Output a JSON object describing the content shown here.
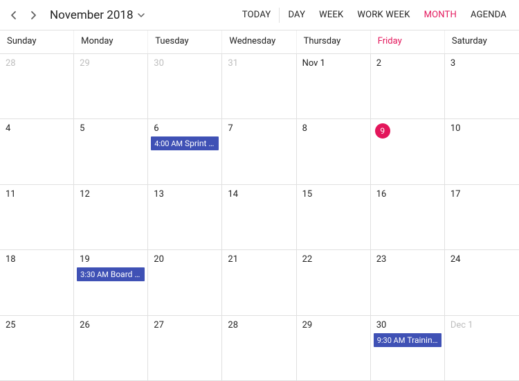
{
  "toolbar": {
    "title": "November 2018",
    "today_label": "TODAY",
    "views": [
      {
        "key": "day",
        "label": "DAY",
        "active": false
      },
      {
        "key": "week",
        "label": "WEEK",
        "active": false
      },
      {
        "key": "workweek",
        "label": "WORK WEEK",
        "active": false
      },
      {
        "key": "month",
        "label": "MONTH",
        "active": true
      },
      {
        "key": "agenda",
        "label": "AGENDA",
        "active": false
      }
    ]
  },
  "day_headers": [
    {
      "label": "Sunday",
      "highlight": false
    },
    {
      "label": "Monday",
      "highlight": false
    },
    {
      "label": "Tuesday",
      "highlight": false
    },
    {
      "label": "Wednesday",
      "highlight": false
    },
    {
      "label": "Thursday",
      "highlight": false
    },
    {
      "label": "Friday",
      "highlight": true
    },
    {
      "label": "Saturday",
      "highlight": false
    }
  ],
  "today_date": "9",
  "cells": [
    {
      "label": "28",
      "other": true,
      "today": false,
      "events": []
    },
    {
      "label": "29",
      "other": true,
      "today": false,
      "events": []
    },
    {
      "label": "30",
      "other": true,
      "today": false,
      "events": []
    },
    {
      "label": "31",
      "other": true,
      "today": false,
      "events": []
    },
    {
      "label": "Nov 1",
      "other": false,
      "today": false,
      "events": []
    },
    {
      "label": "2",
      "other": false,
      "today": false,
      "events": []
    },
    {
      "label": "3",
      "other": false,
      "today": false,
      "events": []
    },
    {
      "label": "4",
      "other": false,
      "today": false,
      "events": []
    },
    {
      "label": "5",
      "other": false,
      "today": false,
      "events": []
    },
    {
      "label": "6",
      "other": false,
      "today": false,
      "events": [
        {
          "time": "4:00 AM",
          "title": "Sprint …"
        }
      ]
    },
    {
      "label": "7",
      "other": false,
      "today": false,
      "events": []
    },
    {
      "label": "8",
      "other": false,
      "today": false,
      "events": []
    },
    {
      "label": "9",
      "other": false,
      "today": true,
      "events": []
    },
    {
      "label": "10",
      "other": false,
      "today": false,
      "events": []
    },
    {
      "label": "11",
      "other": false,
      "today": false,
      "events": []
    },
    {
      "label": "12",
      "other": false,
      "today": false,
      "events": []
    },
    {
      "label": "13",
      "other": false,
      "today": false,
      "events": []
    },
    {
      "label": "14",
      "other": false,
      "today": false,
      "events": []
    },
    {
      "label": "15",
      "other": false,
      "today": false,
      "events": []
    },
    {
      "label": "16",
      "other": false,
      "today": false,
      "events": []
    },
    {
      "label": "17",
      "other": false,
      "today": false,
      "events": []
    },
    {
      "label": "18",
      "other": false,
      "today": false,
      "events": []
    },
    {
      "label": "19",
      "other": false,
      "today": false,
      "events": [
        {
          "time": "3:30 AM",
          "title": "Board …"
        }
      ]
    },
    {
      "label": "20",
      "other": false,
      "today": false,
      "events": []
    },
    {
      "label": "21",
      "other": false,
      "today": false,
      "events": []
    },
    {
      "label": "22",
      "other": false,
      "today": false,
      "events": []
    },
    {
      "label": "23",
      "other": false,
      "today": false,
      "events": []
    },
    {
      "label": "24",
      "other": false,
      "today": false,
      "events": []
    },
    {
      "label": "25",
      "other": false,
      "today": false,
      "events": []
    },
    {
      "label": "26",
      "other": false,
      "today": false,
      "events": []
    },
    {
      "label": "27",
      "other": false,
      "today": false,
      "events": []
    },
    {
      "label": "28",
      "other": false,
      "today": false,
      "events": []
    },
    {
      "label": "29",
      "other": false,
      "today": false,
      "events": []
    },
    {
      "label": "30",
      "other": false,
      "today": false,
      "events": [
        {
          "time": "9:30 AM",
          "title": "Trainin…"
        }
      ]
    },
    {
      "label": "Dec 1",
      "other": true,
      "today": false,
      "events": []
    }
  ],
  "colors": {
    "accent": "#e3165b",
    "event_bg": "#3f51b5"
  }
}
